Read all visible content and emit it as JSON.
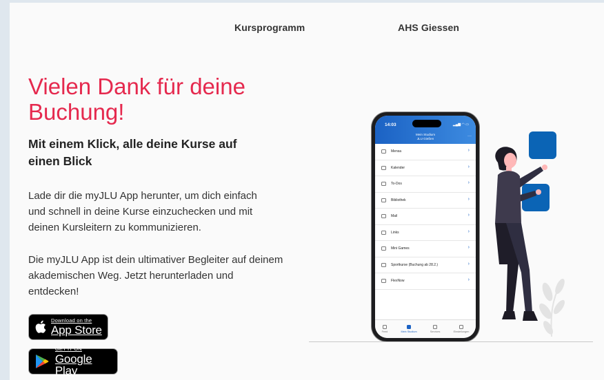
{
  "nav": {
    "kursprogramm": "Kursprogramm",
    "ahs": "AHS Giessen"
  },
  "hero": {
    "title": "Vielen Dank für deine Buchung!",
    "subtitle": "Mit einem Klick, alle deine Kurse auf einen Blick",
    "paragraph1": "Lade dir die myJLU App herunter, um dich einfach und schnell in deine Kurse einzuchecken und mit deinen Kursleitern zu kommunizieren.",
    "paragraph2": "Die myJLU App ist dein ultimativer Begleiter auf deinem akademischen Weg. Jetzt herunterladen und entdecken!"
  },
  "stores": {
    "apple_small": "Download on the",
    "apple_big": "App Store",
    "google_small": "GET IT ON",
    "google_big": "Google Play"
  },
  "phone": {
    "time": "14:03",
    "header_line1": "Mein Studium",
    "header_line2": "JLU Gießen",
    "items": [
      "Mensa",
      "Kalender",
      "To-Dos",
      "Bibliothek",
      "Mail",
      "Links",
      "Mini Games",
      "Sportkurse (Buchung ab 28.2.)",
      "FlexNow"
    ],
    "tabs": [
      "Feed",
      "Mein Studium",
      "Services",
      "Einstellungen"
    ]
  },
  "colors": {
    "accent": "#e5294e",
    "phone_blue": "#1b62c4",
    "tile_blue": "#0b64b5",
    "figure_dark": "#2f2e41",
    "skin": "#ffb8b8"
  }
}
